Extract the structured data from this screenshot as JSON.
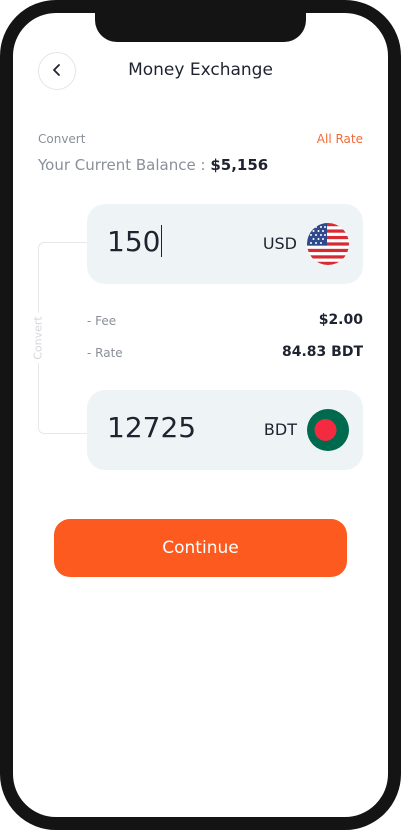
{
  "header": {
    "title": "Money Exchange"
  },
  "convert": {
    "label": "Convert",
    "all_rate_link": "All Rate",
    "balance_label": "Your Current Balance :",
    "balance_value": "$5,156"
  },
  "from": {
    "amount": "150",
    "currency": "USD",
    "flag_icon": "us-flag-icon"
  },
  "details": {
    "fee_label": "- Fee",
    "fee_value": "$2.00",
    "rate_label": "- Rate",
    "rate_value": "84.83 BDT"
  },
  "bracket_label": "Convert",
  "to": {
    "amount": "12725",
    "currency": "BDT",
    "flag_icon": "bangladesh-flag-icon"
  },
  "continue_label": "Continue",
  "colors": {
    "accent": "#fc5a1e",
    "link": "#f26a3a",
    "card_bg": "#eef3f6",
    "text_dark": "#1f2330",
    "text_muted": "#8a8f99",
    "phone_frame": "#141414"
  }
}
